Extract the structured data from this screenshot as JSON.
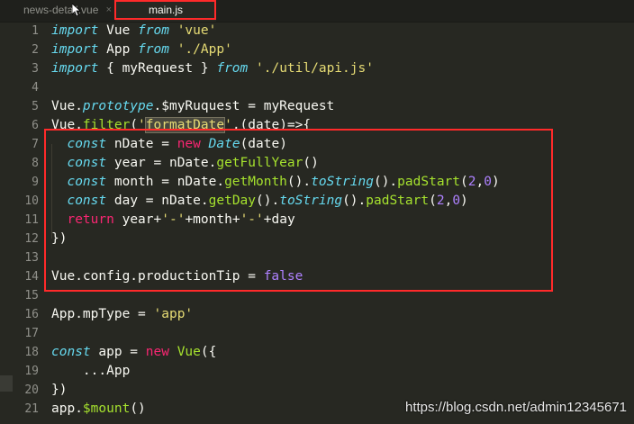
{
  "tabs": {
    "inactive": {
      "label": "news-detail.vue",
      "close": "×"
    },
    "active": {
      "label": "main.js"
    }
  },
  "lines": [
    {
      "n": "1"
    },
    {
      "n": "2"
    },
    {
      "n": "3"
    },
    {
      "n": "4"
    },
    {
      "n": "5"
    },
    {
      "n": "6"
    },
    {
      "n": "7"
    },
    {
      "n": "8"
    },
    {
      "n": "9"
    },
    {
      "n": "10"
    },
    {
      "n": "11"
    },
    {
      "n": "12"
    },
    {
      "n": "13"
    },
    {
      "n": "14"
    },
    {
      "n": "15"
    },
    {
      "n": "16"
    },
    {
      "n": "17"
    },
    {
      "n": "18"
    },
    {
      "n": "19"
    },
    {
      "n": "20"
    },
    {
      "n": "21"
    }
  ],
  "code": {
    "l1": [
      {
        "t": "import",
        "c": "kw-it"
      },
      {
        "t": " Vue "
      },
      {
        "t": "from",
        "c": "kw-it"
      },
      {
        "t": " "
      },
      {
        "t": "'vue'",
        "c": "str"
      }
    ],
    "l2": [
      {
        "t": "import",
        "c": "kw-it"
      },
      {
        "t": " App "
      },
      {
        "t": "from",
        "c": "kw-it"
      },
      {
        "t": " "
      },
      {
        "t": "'./App'",
        "c": "str"
      }
    ],
    "l3": [
      {
        "t": "import",
        "c": "kw-it"
      },
      {
        "t": " { myRequest } "
      },
      {
        "t": "from",
        "c": "kw-it"
      },
      {
        "t": " "
      },
      {
        "t": "'./util/api.js'",
        "c": "str"
      }
    ],
    "l5": [
      {
        "t": "Vue."
      },
      {
        "t": "prototype",
        "c": "kw-it"
      },
      {
        "t": ".$myRuquest = myRequest"
      }
    ],
    "l6": [
      {
        "t": "Vue."
      },
      {
        "t": "filter",
        "c": "fn"
      },
      {
        "t": "("
      },
      {
        "t": "'",
        "c": "str"
      },
      {
        "t": "formatDate",
        "c": "str hl"
      },
      {
        "t": "'",
        "c": "str"
      },
      {
        "t": ",(date)=>{"
      }
    ],
    "l7": [
      {
        "t": "  "
      },
      {
        "t": "const",
        "c": "kw-it"
      },
      {
        "t": " nDate = "
      },
      {
        "t": "new",
        "c": "kw"
      },
      {
        "t": " "
      },
      {
        "t": "Date",
        "c": "kw-it"
      },
      {
        "t": "(date)"
      }
    ],
    "l8": [
      {
        "t": "  "
      },
      {
        "t": "const",
        "c": "kw-it"
      },
      {
        "t": " year = nDate."
      },
      {
        "t": "getFullYear",
        "c": "fn"
      },
      {
        "t": "()"
      }
    ],
    "l9": [
      {
        "t": "  "
      },
      {
        "t": "const",
        "c": "kw-it"
      },
      {
        "t": " month = nDate."
      },
      {
        "t": "getMonth",
        "c": "fn"
      },
      {
        "t": "()."
      },
      {
        "t": "toString",
        "c": "kw-it"
      },
      {
        "t": "()."
      },
      {
        "t": "padStart",
        "c": "fn"
      },
      {
        "t": "("
      },
      {
        "t": "2",
        "c": "num"
      },
      {
        "t": ","
      },
      {
        "t": "0",
        "c": "num"
      },
      {
        "t": ")"
      }
    ],
    "l10": [
      {
        "t": "  "
      },
      {
        "t": "const",
        "c": "kw-it"
      },
      {
        "t": " day = nDate."
      },
      {
        "t": "getDay",
        "c": "fn"
      },
      {
        "t": "()."
      },
      {
        "t": "toString",
        "c": "kw-it"
      },
      {
        "t": "()."
      },
      {
        "t": "padStart",
        "c": "fn"
      },
      {
        "t": "("
      },
      {
        "t": "2",
        "c": "num"
      },
      {
        "t": ","
      },
      {
        "t": "0",
        "c": "num"
      },
      {
        "t": ")"
      }
    ],
    "l11": [
      {
        "t": "  "
      },
      {
        "t": "return",
        "c": "kw"
      },
      {
        "t": " year+"
      },
      {
        "t": "'-'",
        "c": "str"
      },
      {
        "t": "+month+"
      },
      {
        "t": "'-'",
        "c": "str"
      },
      {
        "t": "+day"
      }
    ],
    "l12": [
      {
        "t": "})"
      }
    ],
    "l14": [
      {
        "t": "Vue.config.productionTip = "
      },
      {
        "t": "false",
        "c": "num"
      }
    ],
    "l16": [
      {
        "t": "App.mpType = "
      },
      {
        "t": "'app'",
        "c": "str"
      }
    ],
    "l18": [
      {
        "t": "const",
        "c": "kw-it"
      },
      {
        "t": " app = "
      },
      {
        "t": "new",
        "c": "kw"
      },
      {
        "t": " "
      },
      {
        "t": "Vue",
        "c": "fn"
      },
      {
        "t": "({"
      }
    ],
    "l19": [
      {
        "t": "    ...App"
      }
    ],
    "l20": [
      {
        "t": "})"
      }
    ],
    "l21": [
      {
        "t": "app."
      },
      {
        "t": "$mount",
        "c": "fn"
      },
      {
        "t": "()"
      }
    ]
  },
  "watermark": "https://blog.csdn.net/admin12345671",
  "colors": {
    "background": "#272822",
    "annotation": "#ff2a2a"
  }
}
